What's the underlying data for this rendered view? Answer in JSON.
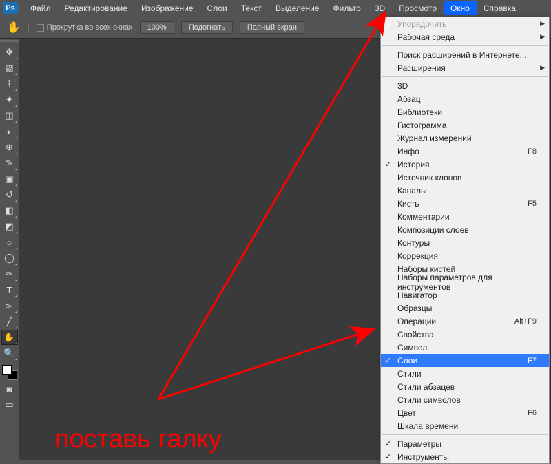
{
  "menubar": {
    "logo": "Ps",
    "items": [
      "Файл",
      "Редактирование",
      "Изображение",
      "Слои",
      "Текст",
      "Выделение",
      "Фильтр",
      "3D",
      "Просмотр",
      "Окно",
      "Справка"
    ],
    "activeIndex": 9
  },
  "optionsbar": {
    "scrollAllWindows": "Прокрутка во всех окнах",
    "btn1": "100%",
    "btn2": "Подогнать",
    "btn3": "Полный экран"
  },
  "tools": [
    {
      "name": "move-tool",
      "glyph": "✥"
    },
    {
      "name": "rect-marquee-tool",
      "glyph": "▧"
    },
    {
      "name": "lasso-tool",
      "glyph": "⌇"
    },
    {
      "name": "magic-wand-tool",
      "glyph": "✦"
    },
    {
      "name": "crop-tool",
      "glyph": "◫"
    },
    {
      "name": "eyedropper-tool",
      "glyph": "◐"
    },
    {
      "name": "healing-brush-tool",
      "glyph": "⊕"
    },
    {
      "name": "brush-tool",
      "glyph": "✎"
    },
    {
      "name": "clone-stamp-tool",
      "glyph": "▣"
    },
    {
      "name": "history-brush-tool",
      "glyph": "↺"
    },
    {
      "name": "eraser-tool",
      "glyph": "◧"
    },
    {
      "name": "gradient-tool",
      "glyph": "◩"
    },
    {
      "name": "blur-tool",
      "glyph": "○"
    },
    {
      "name": "dodge-tool",
      "glyph": "◯"
    },
    {
      "name": "pen-tool",
      "glyph": "✑"
    },
    {
      "name": "type-tool",
      "glyph": "T"
    },
    {
      "name": "path-select-tool",
      "glyph": "▻"
    },
    {
      "name": "line-tool",
      "glyph": "╱"
    },
    {
      "name": "hand-tool",
      "glyph": "✋",
      "selected": true
    },
    {
      "name": "zoom-tool",
      "glyph": "🔍"
    }
  ],
  "bottomTools": [
    {
      "name": "quick-mask-toggle",
      "glyph": "◙"
    },
    {
      "name": "screen-mode-toggle",
      "glyph": "▭"
    }
  ],
  "dropdown": {
    "rows": [
      {
        "label": "Упорядочить",
        "sub": true,
        "disabled": true
      },
      {
        "label": "Рабочая среда",
        "sub": true
      },
      {
        "sep": true
      },
      {
        "label": "Поиск расширений в Интернете..."
      },
      {
        "label": "Расширения",
        "sub": true
      },
      {
        "sep": true
      },
      {
        "label": "3D"
      },
      {
        "label": "Абзац"
      },
      {
        "label": "Библиотеки"
      },
      {
        "label": "Гистограмма"
      },
      {
        "label": "Журнал измерений"
      },
      {
        "label": "Инфо",
        "shortcut": "F8"
      },
      {
        "label": "История",
        "check": true
      },
      {
        "label": "Источник клонов"
      },
      {
        "label": "Каналы"
      },
      {
        "label": "Кисть",
        "shortcut": "F5"
      },
      {
        "label": "Комментарии"
      },
      {
        "label": "Композиции слоев"
      },
      {
        "label": "Контуры"
      },
      {
        "label": "Коррекция"
      },
      {
        "label": "Наборы кистей"
      },
      {
        "label": "Наборы параметров для инструментов"
      },
      {
        "label": "Навигатор"
      },
      {
        "label": "Образцы"
      },
      {
        "label": "Операции",
        "shortcut": "Alt+F9"
      },
      {
        "label": "Свойства"
      },
      {
        "label": "Символ"
      },
      {
        "label": "Слои",
        "shortcut": "F7",
        "check": true,
        "hl": true
      },
      {
        "label": "Стили"
      },
      {
        "label": "Стили абзацев"
      },
      {
        "label": "Стили символов"
      },
      {
        "label": "Цвет",
        "shortcut": "F6"
      },
      {
        "label": "Шкала времени"
      },
      {
        "sep": true
      },
      {
        "label": "Параметры",
        "check": true
      },
      {
        "label": "Инструменты",
        "check": true
      }
    ]
  },
  "annotation": "поставь галку"
}
